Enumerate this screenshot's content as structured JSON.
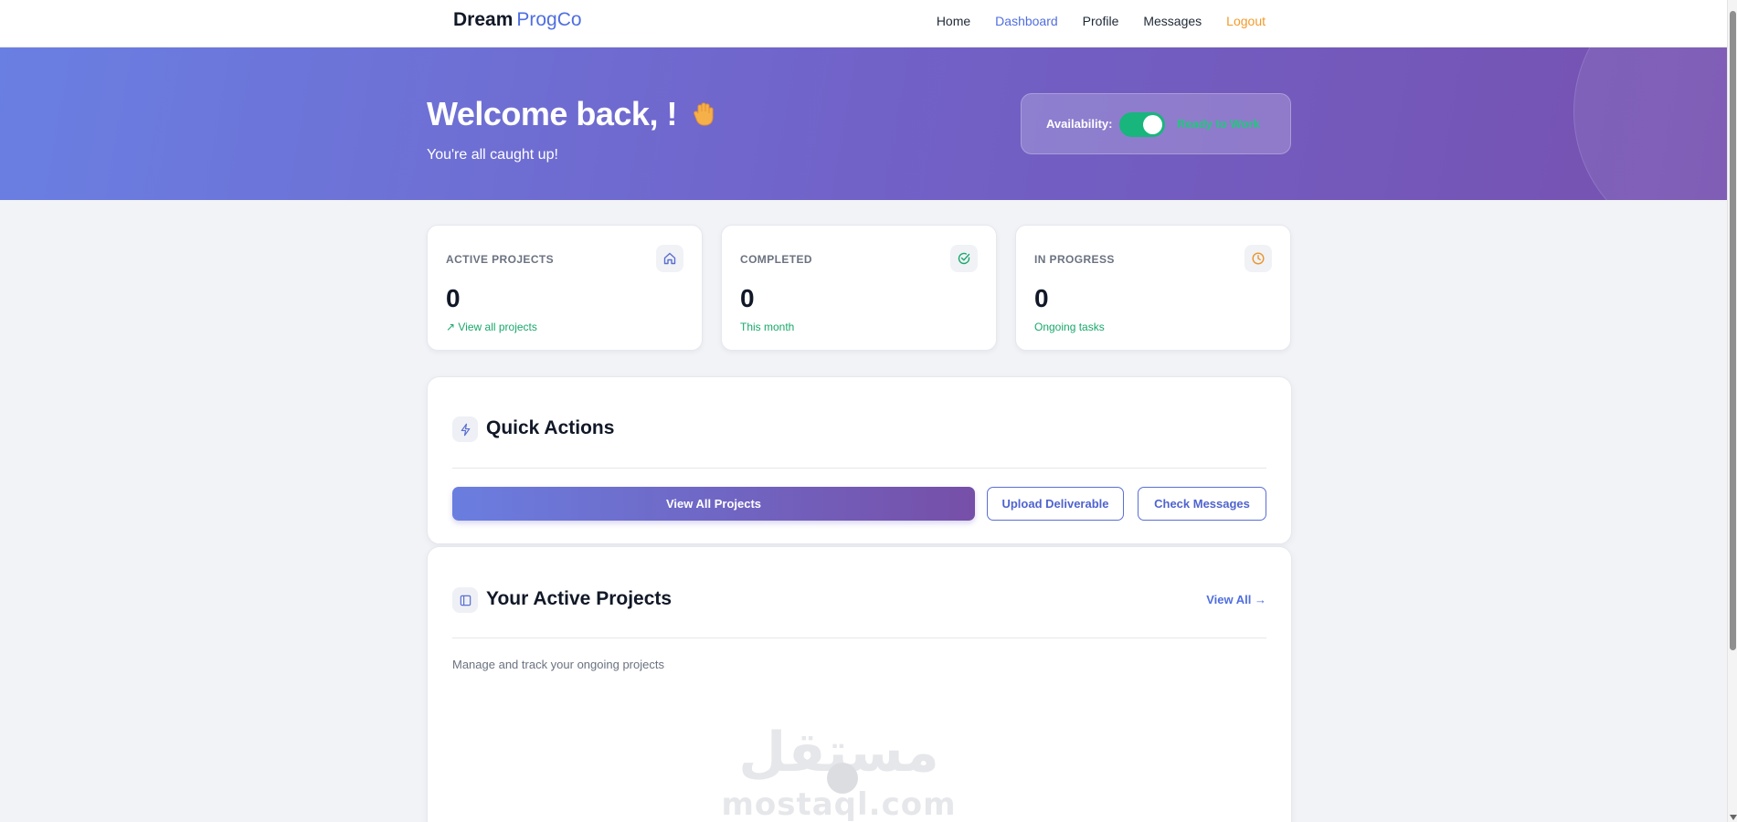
{
  "brand": {
    "name": "Dream",
    "accent": "ProgCo"
  },
  "nav": {
    "home": "Home",
    "dashboard": "Dashboard",
    "profile": "Profile",
    "messages": "Messages",
    "logout": "Logout"
  },
  "hero": {
    "title": "Welcome back, !",
    "subtitle": "You're all caught up!",
    "availability_label": "Availability:",
    "availability_status": "Ready to Work",
    "availability_on": true
  },
  "stats": [
    {
      "label": "ACTIVE PROJECTS",
      "value": "0",
      "link": "↗ View all projects",
      "icon": "home-icon"
    },
    {
      "label": "COMPLETED",
      "value": "0",
      "link": "This month",
      "icon": "check-circle-icon"
    },
    {
      "label": "IN PROGRESS",
      "value": "0",
      "link": "Ongoing tasks",
      "icon": "clock-icon"
    }
  ],
  "quick_actions": {
    "title": "Quick Actions",
    "view_all_projects": "View All Projects",
    "upload_deliverable": "Upload Deliverable",
    "check_messages": "Check Messages"
  },
  "active_projects": {
    "title": "Your Active Projects",
    "view_all": "View All →",
    "description": "Manage and track your ongoing projects"
  },
  "watermark": {
    "arabic": "مستقل",
    "latin": "mostaql.com"
  },
  "colors": {
    "accent": "#4f6ee0",
    "logout": "#f39a2a",
    "success": "#18a86b",
    "toggle_on": "#18b57d"
  }
}
